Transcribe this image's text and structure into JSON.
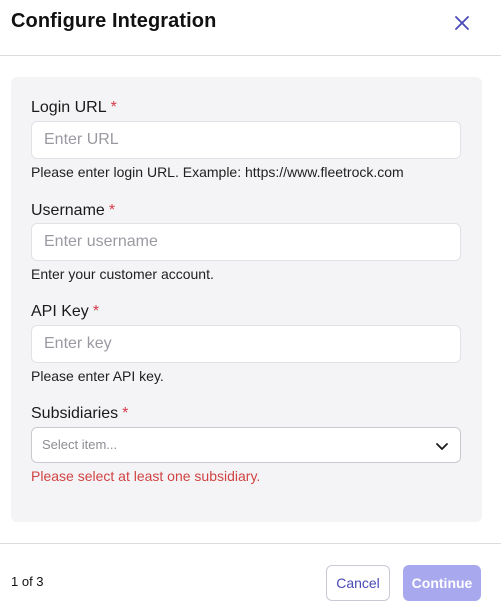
{
  "modal": {
    "title": "Configure Integration",
    "close_icon": "close-icon"
  },
  "form": {
    "login_url": {
      "label": "Login URL",
      "required_mark": "*",
      "placeholder": "Enter URL",
      "value": "",
      "help": "Please enter login URL. Example: https://www.fleetrock.com"
    },
    "username": {
      "label": "Username",
      "required_mark": "*",
      "placeholder": "Enter username",
      "value": "",
      "help": "Enter your customer account."
    },
    "api_key": {
      "label": "API Key",
      "required_mark": "*",
      "placeholder": "Enter key",
      "value": "",
      "help": "Please enter API key."
    },
    "subsidiaries": {
      "label": "Subsidiaries",
      "required_mark": "*",
      "placeholder": "Select item...",
      "error": "Please select at least one subsidiary.",
      "icon": "chevron-down-icon"
    }
  },
  "footer": {
    "step": "1 of 3",
    "cancel_label": "Cancel",
    "continue_label": "Continue"
  },
  "colors": {
    "accent": "#4a4ab8",
    "accent_disabled": "#a8a8ee",
    "required": "#d73a49",
    "error": "#d14343"
  }
}
